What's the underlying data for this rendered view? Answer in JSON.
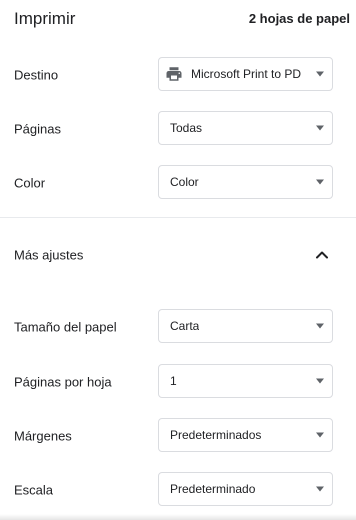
{
  "header": {
    "title": "Imprimir",
    "sheets": "2 hojas de papel"
  },
  "rows": [
    {
      "label": "Destino",
      "value": "Microsoft Print to PD",
      "icon": "printer-icon"
    },
    {
      "label": "Páginas",
      "value": "Todas"
    },
    {
      "label": "Color",
      "value": "Color"
    }
  ],
  "more_settings": {
    "label": "Más ajustes",
    "icon": "chevron-up-icon"
  },
  "advanced_rows": [
    {
      "label": "Tamaño del papel",
      "value": "Carta"
    },
    {
      "label": "Páginas por hoja",
      "value": "1"
    },
    {
      "label": "Márgenes",
      "value": "Predeterminados"
    },
    {
      "label": "Escala",
      "value": "Predeterminado"
    }
  ],
  "colors": {
    "text": "#202124",
    "border": "#dadce0",
    "icon": "#5f6368"
  }
}
